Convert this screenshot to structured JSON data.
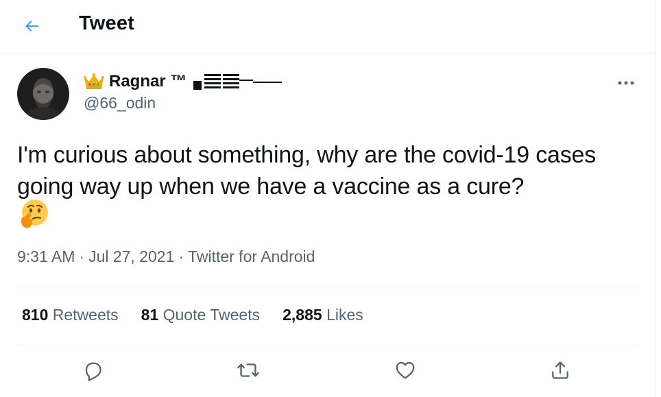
{
  "header": {
    "back_icon": "arrow-left-icon",
    "title": "Tweet",
    "accent_color": "#1d9bf0"
  },
  "tweet": {
    "author": {
      "display_name": "Ragnar ™",
      "handle": "@66_odin",
      "avatar_icon": "user-avatar",
      "badge_icon": "crown-icon"
    },
    "more_icon": "more-horizontal-icon",
    "text": "I'm curious about something, why are the covid-19 cases going way up when we have a vaccine as a cure?",
    "emoji_icon": "thinking-face-emoji",
    "time": "9:31 AM",
    "date": "Jul 27, 2021",
    "source": "Twitter for Android",
    "separator": "·"
  },
  "stats": {
    "retweets": {
      "count": "810",
      "label": "Retweets"
    },
    "quote_tweets": {
      "count": "81",
      "label": "Quote Tweets"
    },
    "likes": {
      "count": "2,885",
      "label": "Likes"
    }
  },
  "actions": {
    "reply_icon": "reply-icon",
    "retweet_icon": "retweet-icon",
    "like_icon": "heart-icon",
    "share_icon": "share-icon",
    "icon_color": "#536471"
  }
}
